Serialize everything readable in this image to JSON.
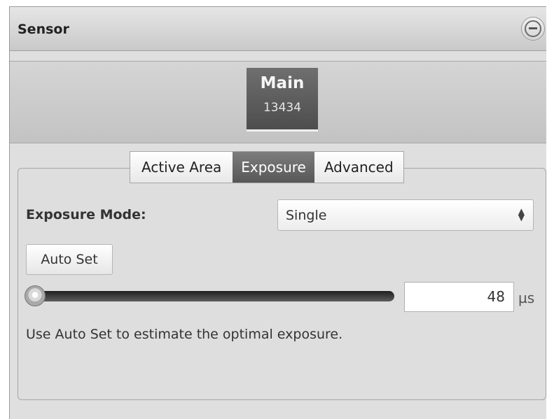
{
  "header": {
    "title": "Sensor"
  },
  "sensor_selector": {
    "name": "Main",
    "value": "13434"
  },
  "tabs": [
    {
      "label": "Active Area",
      "active": false
    },
    {
      "label": "Exposure",
      "active": true
    },
    {
      "label": "Advanced",
      "active": false
    }
  ],
  "exposure": {
    "mode_label": "Exposure Mode:",
    "mode_value": "Single",
    "auto_set_label": "Auto Set",
    "value": "48",
    "unit": "µs",
    "slider_position": 0,
    "help_text": "Use Auto Set to estimate the optimal exposure."
  },
  "icons": {
    "collapse": "minus-circle-icon",
    "select_arrows": "up-down-arrows-icon"
  },
  "colors": {
    "active_tab": "#676767",
    "panel_background": "#dfdfdf"
  }
}
